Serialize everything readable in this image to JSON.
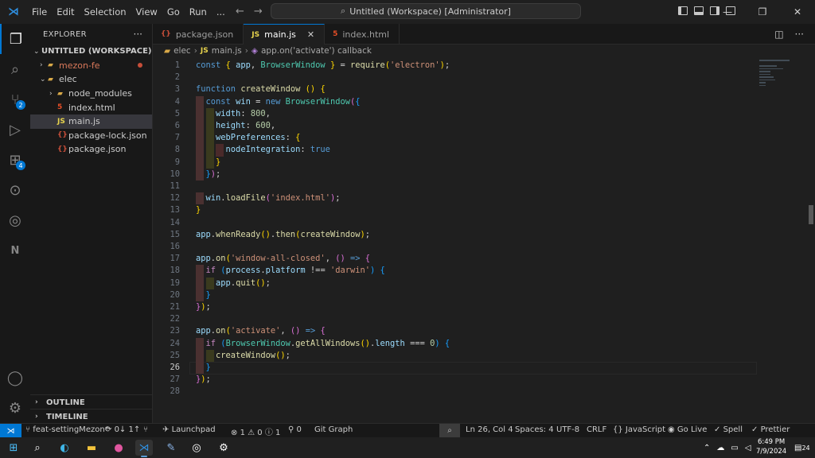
{
  "titlebar": {
    "menu": [
      "File",
      "Edit",
      "Selection",
      "View",
      "Go",
      "Run",
      "..."
    ],
    "command_center": "Untitled (Workspace) [Administrator]"
  },
  "activity_badges": {
    "source_control": "2",
    "extensions": "4"
  },
  "sidebar": {
    "title": "EXPLORER",
    "workspace": "UNTITLED (WORKSPACE)",
    "items": [
      {
        "label": "mezon-fe",
        "kind": "folder",
        "depth": 0,
        "expanded": false,
        "color": "#d9785a"
      },
      {
        "label": "elec",
        "kind": "folder",
        "depth": 0,
        "expanded": true,
        "color": "#cccccc"
      },
      {
        "label": "node_modules",
        "kind": "folder",
        "depth": 1,
        "expanded": false,
        "color": "#cccccc"
      },
      {
        "label": "index.html",
        "kind": "html",
        "depth": 1,
        "color": "#cccccc"
      },
      {
        "label": "main.js",
        "kind": "js",
        "depth": 1,
        "selected": true,
        "color": "#cccccc"
      },
      {
        "label": "package-lock.json",
        "kind": "json",
        "depth": 1,
        "color": "#cccccc"
      },
      {
        "label": "package.json",
        "kind": "json",
        "depth": 1,
        "color": "#cccccc"
      }
    ],
    "outline": "OUTLINE",
    "timeline": "TIMELINE"
  },
  "tabs": [
    {
      "label": "package.json",
      "icon": "{}",
      "active": false
    },
    {
      "label": "main.js",
      "icon": "JS",
      "active": true
    },
    {
      "label": "index.html",
      "icon": "5",
      "active": false
    }
  ],
  "breadcrumb": {
    "folder": "elec",
    "file": "main.js",
    "symbol": "app.on('activate') callback"
  },
  "editor": {
    "current_line": 26,
    "lines": [
      [
        [
          "kw",
          "const "
        ],
        [
          "br1",
          "{ "
        ],
        [
          "var",
          "app"
        ],
        [
          "pl",
          ", "
        ],
        [
          "cls",
          "BrowserWindow"
        ],
        [
          "br1",
          " }"
        ],
        [
          "pl",
          " = "
        ],
        [
          "fn",
          "require"
        ],
        [
          "br1",
          "("
        ],
        [
          "str",
          "'electron'"
        ],
        [
          "br1",
          ")"
        ],
        [
          "pl",
          ";"
        ]
      ],
      [],
      [
        [
          "kw",
          "function "
        ],
        [
          "fn",
          "createWindow"
        ],
        [
          "pl",
          " "
        ],
        [
          "br1",
          "()"
        ],
        [
          "pl",
          " "
        ],
        [
          "br1",
          "{"
        ]
      ],
      [
        [
          "pl",
          "  "
        ],
        [
          "kw",
          "const "
        ],
        [
          "var",
          "win"
        ],
        [
          "pl",
          " = "
        ],
        [
          "kw",
          "new "
        ],
        [
          "cls",
          "BrowserWindow"
        ],
        [
          "br2",
          "("
        ],
        [
          "br3",
          "{"
        ]
      ],
      [
        [
          "pl",
          "    "
        ],
        [
          "var",
          "width"
        ],
        [
          "pl",
          ": "
        ],
        [
          "num",
          "800"
        ],
        [
          "pl",
          ","
        ]
      ],
      [
        [
          "pl",
          "    "
        ],
        [
          "var",
          "height"
        ],
        [
          "pl",
          ": "
        ],
        [
          "num",
          "600"
        ],
        [
          "pl",
          ","
        ]
      ],
      [
        [
          "pl",
          "    "
        ],
        [
          "var",
          "webPreferences"
        ],
        [
          "pl",
          ": "
        ],
        [
          "br1",
          "{"
        ]
      ],
      [
        [
          "pl",
          "      "
        ],
        [
          "var",
          "nodeIntegration"
        ],
        [
          "pl",
          ": "
        ],
        [
          "kw",
          "true"
        ]
      ],
      [
        [
          "pl",
          "    "
        ],
        [
          "br1",
          "}"
        ]
      ],
      [
        [
          "pl",
          "  "
        ],
        [
          "br3",
          "}"
        ],
        [
          "br2",
          ")"
        ],
        [
          "pl",
          ";"
        ]
      ],
      [],
      [
        [
          "pl",
          "  "
        ],
        [
          "var",
          "win"
        ],
        [
          "pl",
          "."
        ],
        [
          "fn",
          "loadFile"
        ],
        [
          "br2",
          "("
        ],
        [
          "str",
          "'index.html'"
        ],
        [
          "br2",
          ")"
        ],
        [
          "pl",
          ";"
        ]
      ],
      [
        [
          "br1",
          "}"
        ]
      ],
      [],
      [
        [
          "var",
          "app"
        ],
        [
          "pl",
          "."
        ],
        [
          "fn",
          "whenReady"
        ],
        [
          "br1",
          "()"
        ],
        [
          "pl",
          "."
        ],
        [
          "fn",
          "then"
        ],
        [
          "br1",
          "("
        ],
        [
          "fn",
          "createWindow"
        ],
        [
          "br1",
          ")"
        ],
        [
          "pl",
          ";"
        ]
      ],
      [],
      [
        [
          "var",
          "app"
        ],
        [
          "pl",
          "."
        ],
        [
          "fn",
          "on"
        ],
        [
          "br1",
          "("
        ],
        [
          "str",
          "'window-all-closed'"
        ],
        [
          "pl",
          ", "
        ],
        [
          "br2",
          "()"
        ],
        [
          "pl",
          " "
        ],
        [
          "kw",
          "=>"
        ],
        [
          "pl",
          " "
        ],
        [
          "br2",
          "{"
        ]
      ],
      [
        [
          "pl",
          "  "
        ],
        [
          "ctl",
          "if "
        ],
        [
          "br3",
          "("
        ],
        [
          "var",
          "process"
        ],
        [
          "pl",
          "."
        ],
        [
          "var",
          "platform"
        ],
        [
          "pl",
          " !== "
        ],
        [
          "str",
          "'darwin'"
        ],
        [
          "br3",
          ")"
        ],
        [
          "pl",
          " "
        ],
        [
          "br3",
          "{"
        ]
      ],
      [
        [
          "pl",
          "    "
        ],
        [
          "var",
          "app"
        ],
        [
          "pl",
          "."
        ],
        [
          "fn",
          "quit"
        ],
        [
          "br1",
          "()"
        ],
        [
          "pl",
          ";"
        ]
      ],
      [
        [
          "pl",
          "  "
        ],
        [
          "br3",
          "}"
        ]
      ],
      [
        [
          "br2",
          "}"
        ],
        [
          "br1",
          ")"
        ],
        [
          "pl",
          ";"
        ]
      ],
      [],
      [
        [
          "var",
          "app"
        ],
        [
          "pl",
          "."
        ],
        [
          "fn",
          "on"
        ],
        [
          "br1",
          "("
        ],
        [
          "str",
          "'activate'"
        ],
        [
          "pl",
          ", "
        ],
        [
          "br2",
          "()"
        ],
        [
          "pl",
          " "
        ],
        [
          "kw",
          "=>"
        ],
        [
          "pl",
          " "
        ],
        [
          "br2",
          "{"
        ]
      ],
      [
        [
          "pl",
          "  "
        ],
        [
          "ctl",
          "if "
        ],
        [
          "br3",
          "("
        ],
        [
          "cls",
          "BrowserWindow"
        ],
        [
          "pl",
          "."
        ],
        [
          "fn",
          "getAllWindows"
        ],
        [
          "br1",
          "()"
        ],
        [
          "pl",
          "."
        ],
        [
          "var",
          "length"
        ],
        [
          "pl",
          " === "
        ],
        [
          "num",
          "0"
        ],
        [
          "br3",
          ")"
        ],
        [
          "pl",
          " "
        ],
        [
          "br3",
          "{"
        ]
      ],
      [
        [
          "pl",
          "    "
        ],
        [
          "fn",
          "createWindow"
        ],
        [
          "br1",
          "()"
        ],
        [
          "pl",
          ";"
        ]
      ],
      [
        [
          "pl",
          "  "
        ],
        [
          "br3",
          "}"
        ]
      ],
      [
        [
          "br2",
          "}"
        ],
        [
          "br1",
          ")"
        ],
        [
          "pl",
          ";"
        ]
      ],
      []
    ]
  },
  "statusbar": {
    "branch": "feat-settingMezon*",
    "sync": "0↓ 1↑",
    "launchpad": "Launchpad",
    "errors": "1",
    "warnings": "0",
    "info": "1",
    "ports": "0",
    "git_graph": "Git Graph",
    "position": "Ln 26, Col 4",
    "spaces": "Spaces: 4",
    "encoding": "UTF-8",
    "eol": "CRLF",
    "language": "JavaScript",
    "go_live": "Go Live",
    "spell": "Spell",
    "prettier": "Prettier"
  },
  "taskbar": {
    "time": "6:49 PM",
    "date": "7/9/2024",
    "notifications": "24"
  }
}
